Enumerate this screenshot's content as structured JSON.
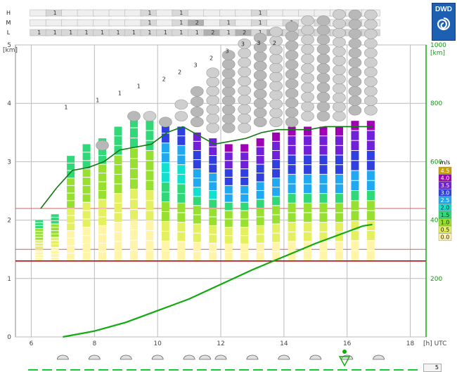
{
  "logo_text": "DWD",
  "chart_data": {
    "type": "bar",
    "x_unit": "[h] UTC",
    "x_ticks": [
      "6",
      "8",
      "10",
      "12",
      "14",
      "16",
      "18"
    ],
    "xlim": [
      5.5,
      18.5
    ],
    "y_left_unit": "[km]",
    "y_left_ticks": [
      "0",
      "1",
      "2",
      "3",
      "4",
      "5"
    ],
    "ylim_left": [
      0,
      5
    ],
    "y_right_unit": "[km]",
    "y_right_ticks": [
      "200",
      "400",
      "600",
      "800",
      "1000"
    ],
    "ylim_right": [
      0,
      1000
    ],
    "grid": true,
    "cloud_levels": [
      "H",
      "M",
      "L"
    ],
    "cloud_cover": {
      "H": [
        "",
        "1",
        "",
        "",
        "",
        "",
        "",
        "1",
        "",
        "1",
        "",
        "",
        "",
        "",
        "1",
        "",
        "",
        "",
        "",
        "",
        "",
        ""
      ],
      "M": [
        "",
        "",
        "",
        "",
        "",
        "",
        "",
        "1",
        "",
        "1",
        "2",
        "",
        "1",
        "",
        "1",
        "",
        "1",
        "",
        "1",
        "",
        "1",
        ""
      ],
      "L": [
        "1",
        "1",
        "1",
        "1",
        "1",
        "1",
        "1",
        "1",
        "1",
        "1",
        "1",
        "2",
        "1",
        "2",
        "1",
        "2",
        "1",
        "1",
        "1",
        "1",
        "1",
        "1"
      ]
    },
    "times": [
      6.25,
      6.75,
      7.25,
      7.75,
      8.25,
      8.75,
      9.25,
      9.75,
      10.25,
      10.75,
      11.25,
      11.75,
      12.25,
      12.75,
      13.25,
      13.75,
      14.25,
      14.75,
      15.25,
      15.75,
      16.25,
      16.75
    ],
    "bar_tops_km": [
      2.0,
      2.1,
      3.1,
      3.3,
      3.4,
      3.6,
      3.75,
      3.7,
      3.65,
      3.6,
      3.5,
      3.4,
      3.3,
      3.3,
      3.4,
      3.5,
      3.6,
      3.6,
      3.6,
      3.6,
      3.7,
      3.7
    ],
    "cloud_top_km": [
      0,
      0,
      0,
      0,
      3.3,
      0,
      3.8,
      3.8,
      3.7,
      4.1,
      4.3,
      4.6,
      4.9,
      5.1,
      5.2,
      5.3,
      5.4,
      5.5,
      5.5,
      5.6,
      5.6,
      5.6
    ],
    "cloud_base_km": [
      0,
      0,
      0,
      0,
      3.2,
      0,
      3.7,
      3.7,
      3.6,
      3.7,
      3.6,
      3.5,
      3.5,
      3.5,
      3.6,
      3.6,
      3.6,
      3.7,
      3.7,
      3.7,
      3.8,
      3.8
    ],
    "cloud_numbers": [
      "",
      "",
      "1",
      "",
      "",
      "",
      "1",
      "1",
      "2",
      "2",
      "3",
      "2",
      "3",
      "",
      "3",
      "2",
      "",
      "",
      "",
      "",
      "",
      ""
    ],
    "cloud_number_times": [
      7.1,
      8.1,
      8.8,
      9.4,
      10.2,
      10.7,
      11.2,
      11.7,
      12.2,
      12.7,
      13.2,
      13.7
    ],
    "cloud_number_values": [
      "1",
      "1",
      "1",
      "1",
      "2",
      "2",
      "3",
      "2",
      "3",
      "3",
      "3",
      "2"
    ],
    "speed_legend_unit": "m/s",
    "speed_legend": [
      {
        "label": "4.5",
        "color": "#c8a000"
      },
      {
        "label": "4.0",
        "color": "#a000b4"
      },
      {
        "label": "3.5",
        "color": "#7020d8"
      },
      {
        "label": "3.0",
        "color": "#3040e0"
      },
      {
        "label": "2.5",
        "color": "#20a8f0"
      },
      {
        "label": "2.0",
        "color": "#10e0d0"
      },
      {
        "label": "1.5",
        "color": "#30d878"
      },
      {
        "label": "1.0",
        "color": "#98e030"
      },
      {
        "label": "0.5",
        "color": "#e4f060"
      },
      {
        "label": "0.0",
        "color": "#fff4a8"
      }
    ],
    "boundary_layer_km": {
      "x": [
        6.3,
        6.8,
        7.3,
        7.8,
        8.3,
        8.8,
        9.3,
        9.8,
        10.3,
        10.8,
        11.3,
        11.8,
        12.3,
        12.8,
        13.3,
        13.8,
        14.3,
        14.8,
        15.3,
        15.8,
        16.3,
        16.8
      ],
      "y": [
        2.2,
        2.55,
        2.85,
        2.9,
        3.0,
        3.2,
        3.25,
        3.3,
        3.5,
        3.6,
        3.45,
        3.3,
        3.35,
        3.4,
        3.5,
        3.55,
        3.55,
        3.55,
        3.6,
        3.6,
        3.6,
        3.6
      ]
    },
    "temperature_line": {
      "x": [
        7.0,
        8.0,
        9.0,
        10.0,
        11.0,
        12.0,
        13.0,
        14.0,
        15.0,
        16.0,
        16.5,
        16.8
      ],
      "y": [
        0,
        20,
        50,
        90,
        130,
        180,
        230,
        275,
        320,
        360,
        380,
        385
      ]
    },
    "red_lines_km": [
      1.3,
      1.5,
      2.2
    ],
    "weather_icon_times": [
      7.0,
      8.0,
      9.0,
      10.0,
      11.0,
      11.5,
      12.0,
      13.0,
      14.0,
      15.0,
      16.0,
      17.0
    ],
    "page_number": "5"
  }
}
